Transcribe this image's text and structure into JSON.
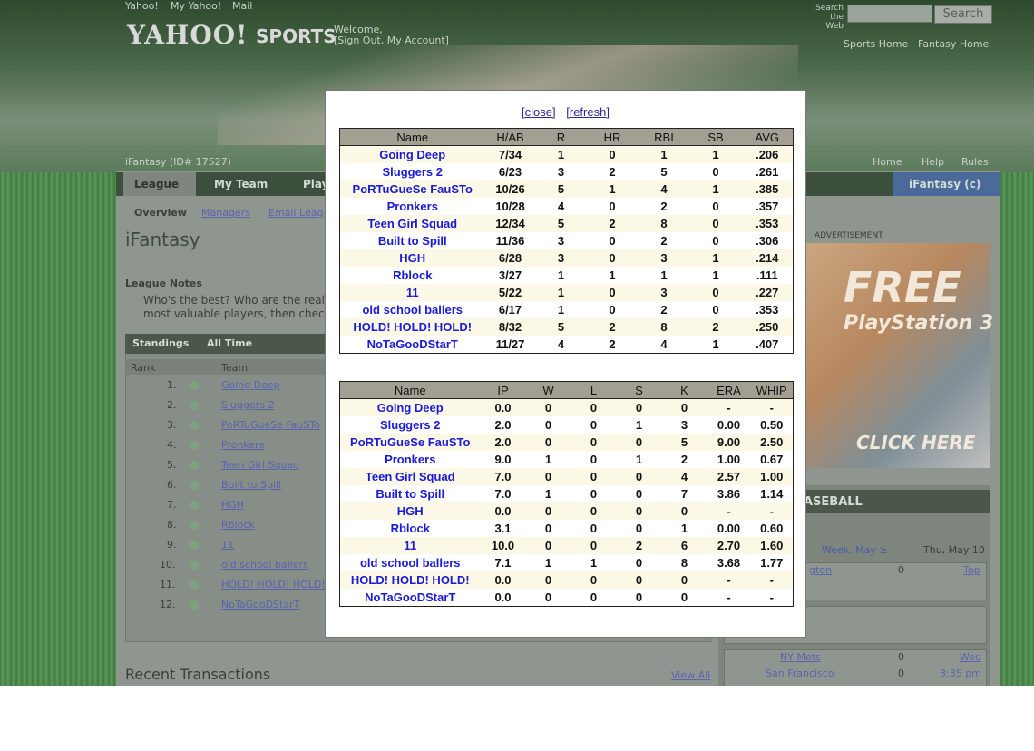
{
  "background": {
    "nav_links": [
      "Yahoo!",
      "My Yahoo!",
      "Mail"
    ],
    "logo": "YAHOO!",
    "logo_sports": "SPORTS",
    "welcome": "Welcome,",
    "welcome_name": "",
    "sign_out": "[Sign Out, My Account]",
    "search_label": "Search the Web",
    "search_button": "Search",
    "top_links": [
      "Sports Home",
      "Fantasy Home"
    ],
    "league_title": "iFantasy (ID# 17527)",
    "right_links": [
      "Home",
      "Help",
      "Rules"
    ],
    "tabs": [
      "League",
      "My Team",
      "Play",
      "iFantasy (c)"
    ],
    "subnav": [
      "Overview",
      "Managers",
      "Email Leag"
    ],
    "page_heading": "iFantasy",
    "league_notes_heading": "League Notes",
    "league_notes_text": "Who's the best? Who are the real? Yo...",
    "league_notes_text2": "most valuable players, then check the",
    "standings_tabs": [
      "Standings",
      "All Time"
    ],
    "standings_cols": [
      "Rank",
      "Team"
    ],
    "standings_ranks": [
      "1.",
      "2.",
      "3.",
      "4.",
      "5.",
      "6.",
      "7.",
      "8.",
      "9.",
      "10.",
      "11.",
      "12."
    ],
    "recent_transactions": "Recent Transactions",
    "view_all": "View All",
    "advertisement": "ADVERTISEMENT",
    "ad_free": "FREE",
    "ad_playstation": "PlayStation 3",
    "ad_click": "CLICK HERE",
    "right_header": "ASEBALL",
    "week_label": "Week, May ≥",
    "date_label": "Thu, May 10",
    "games": [
      {
        "team": "gton",
        "score": "0",
        "status": "Top"
      },
      {
        "team": "NY Mets",
        "score": "0",
        "status": "Wed"
      },
      {
        "team": "San Francisco",
        "score": "0",
        "status": "3:35 pm"
      }
    ]
  },
  "popup": {
    "close_label": "[close]",
    "refresh_label": "[refresh]",
    "batting": {
      "columns": [
        "Name",
        "H/AB",
        "R",
        "HR",
        "RBI",
        "SB",
        "AVG"
      ],
      "rows": [
        [
          "Going Deep",
          "7/34",
          "1",
          "0",
          "1",
          "1",
          ".206"
        ],
        [
          "Sluggers 2",
          "6/23",
          "3",
          "2",
          "5",
          "0",
          ".261"
        ],
        [
          "PoRTuGueSe FauSTo",
          "10/26",
          "5",
          "1",
          "4",
          "1",
          ".385"
        ],
        [
          "Pronkers",
          "10/28",
          "4",
          "0",
          "2",
          "0",
          ".357"
        ],
        [
          "Teen Girl Squad",
          "12/34",
          "5",
          "2",
          "8",
          "0",
          ".353"
        ],
        [
          "Built to Spill",
          "11/36",
          "3",
          "0",
          "2",
          "0",
          ".306"
        ],
        [
          "HGH",
          "6/28",
          "3",
          "0",
          "3",
          "1",
          ".214"
        ],
        [
          "Rblock",
          "3/27",
          "1",
          "1",
          "1",
          "1",
          ".111"
        ],
        [
          "11",
          "5/22",
          "1",
          "0",
          "3",
          "0",
          ".227"
        ],
        [
          "old school ballers",
          "6/17",
          "1",
          "0",
          "2",
          "0",
          ".353"
        ],
        [
          "HOLD! HOLD! HOLD!",
          "8/32",
          "5",
          "2",
          "8",
          "2",
          ".250"
        ],
        [
          "NoTaGooDStarT",
          "11/27",
          "4",
          "2",
          "4",
          "1",
          ".407"
        ]
      ]
    },
    "pitching": {
      "columns": [
        "Name",
        "IP",
        "W",
        "L",
        "S",
        "K",
        "ERA",
        "WHIP"
      ],
      "rows": [
        [
          "Going Deep",
          "0.0",
          "0",
          "0",
          "0",
          "0",
          "-",
          "-"
        ],
        [
          "Sluggers 2",
          "2.0",
          "0",
          "0",
          "1",
          "3",
          "0.00",
          "0.50"
        ],
        [
          "PoRTuGueSe FauSTo",
          "2.0",
          "0",
          "0",
          "0",
          "5",
          "9.00",
          "2.50"
        ],
        [
          "Pronkers",
          "9.0",
          "1",
          "0",
          "1",
          "2",
          "1.00",
          "0.67"
        ],
        [
          "Teen Girl Squad",
          "7.0",
          "0",
          "0",
          "0",
          "4",
          "2.57",
          "1.00"
        ],
        [
          "Built to Spill",
          "7.0",
          "1",
          "0",
          "0",
          "7",
          "3.86",
          "1.14"
        ],
        [
          "HGH",
          "0.0",
          "0",
          "0",
          "0",
          "0",
          "-",
          "-"
        ],
        [
          "Rblock",
          "3.1",
          "0",
          "0",
          "0",
          "1",
          "0.00",
          "0.60"
        ],
        [
          "11",
          "10.0",
          "0",
          "0",
          "2",
          "6",
          "2.70",
          "1.60"
        ],
        [
          "old school ballers",
          "7.1",
          "1",
          "1",
          "0",
          "8",
          "3.68",
          "1.77"
        ],
        [
          "HOLD! HOLD! HOLD!",
          "0.0",
          "0",
          "0",
          "0",
          "0",
          "-",
          "-"
        ],
        [
          "NoTaGooDStarT",
          "0.0",
          "0",
          "0",
          "0",
          "0",
          "-",
          "-"
        ]
      ]
    }
  }
}
